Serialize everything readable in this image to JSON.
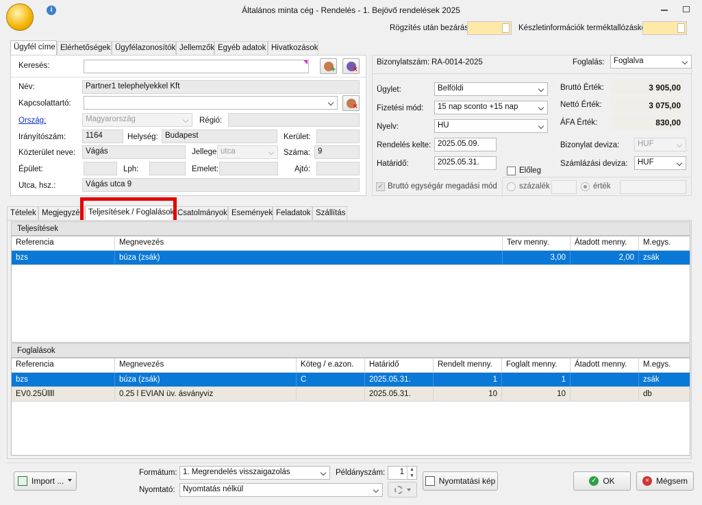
{
  "window": {
    "title": "Általános minta cég - Rendelés - 1. Bejövő rendelések 2025"
  },
  "toolbar": {
    "close_after_save": "Rögzítés után bezárás",
    "stock_info": "Készletinformációk terméktallózáskor"
  },
  "customer_tabs": [
    "Ügyfél címe",
    "Elérhetőségek",
    "Ügyfélazonosítók",
    "Jellemzők",
    "Egyéb adatok",
    "Hivatkozások"
  ],
  "customer": {
    "search_label": "Keresés:",
    "search_value": "",
    "name_label": "Név:",
    "name": "Partner1 telephelyekkel Kft",
    "contact_label": "Kapcsolattartó:",
    "contact": "",
    "country_label": "Ország:",
    "country": "Magyarország",
    "region_label": "Régió:",
    "region": "",
    "zip_label": "Irányítószám:",
    "zip": "1164",
    "city_label": "Helység:",
    "city": "Budapest",
    "district_label": "Kerület:",
    "district": "",
    "street_label": "Közterület neve:",
    "street": "Vágás",
    "street_type_label": "Jellege:",
    "street_type": "utca",
    "number_label": "Száma:",
    "number": "9",
    "building_label": "Épület:",
    "building": "",
    "stair_label": "Lph:",
    "stair": "",
    "floor_label": "Emelet:",
    "floor": "",
    "door_label": "Ajtó:",
    "door": "",
    "address_label": "Utca, hsz.:",
    "address": "Vágás utca 9"
  },
  "doc": {
    "number_label": "Bizonylatszám:",
    "number": "RA-0014-2025",
    "booking_label": "Foglalás:",
    "booking": "Foglalva",
    "deal_label": "Ügylet:",
    "deal": "Belföldi",
    "payment_label": "Fizetési mód:",
    "payment": "15 nap sconto +15 nap",
    "language_label": "Nyelv:",
    "language": "HU",
    "order_date_label": "Rendelés kelte:",
    "order_date": "2025.05.09.",
    "deadline_label": "Határidő:",
    "deadline": "2025.05.31.",
    "gross_label": "Bruttó Érték:",
    "gross": "3 905,00",
    "net_label": "Nettó Érték:",
    "net": "3 075,00",
    "vat_label": "ÁFA Érték:",
    "vat": "830,00",
    "doc_currency_label": "Bizonylat deviza:",
    "doc_currency": "HUF",
    "invoice_currency_label": "Számlázási deviza:",
    "invoice_currency": "HUF",
    "advance_label": "Előleg",
    "gross_price_mode": "Bruttó egységár megadási mód",
    "percent_label": "százalék",
    "value_label": "érték"
  },
  "main_tabs": [
    "Tételek",
    "Megjegyzés",
    "Teljesítések / Foglalások",
    "Csatolmányok",
    "Események",
    "Feladatok",
    "Szállítás"
  ],
  "fulfillments": {
    "title": "Teljesítések",
    "headers": [
      "Referencia",
      "Megnevezés",
      "Terv menny.",
      "Átadott menny.",
      "M.egys."
    ],
    "rows": [
      [
        "bzs",
        "búza (zsák)",
        "3,00",
        "2,00",
        "zsák"
      ]
    ]
  },
  "reservations": {
    "title": "Foglalások",
    "headers": [
      "Referencia",
      "Megnevezés",
      "Köteg / e.azon.",
      "Határidő",
      "Rendelt menny.",
      "Foglalt menny.",
      "Átadott menny.",
      "M.egys."
    ],
    "rows": [
      [
        "bzs",
        "búza (zsák)",
        "C",
        "2025.05.31.",
        "1",
        "1",
        "",
        "zsák"
      ],
      [
        "EV0.25Üllll",
        "0.25 l EVIAN üv. ásványviz",
        "",
        "2025.05.31.",
        "10",
        "10",
        "",
        "db"
      ]
    ]
  },
  "footer": {
    "import_label": "Import ...",
    "format_label": "Formátum:",
    "format": "1. Megrendelés visszaigazolás",
    "copies_label": "Példányszám:",
    "copies": "1",
    "printer_label": "Nyomtató:",
    "printer": "Nyomtatás nélkül",
    "preview_label": "Nyomtatási kép",
    "ok_label": "OK",
    "cancel_label": "Mégsem"
  },
  "colors": {
    "selection": "#0a78d7",
    "highlight": "#e50000",
    "toggle": "#ffe9a8"
  }
}
